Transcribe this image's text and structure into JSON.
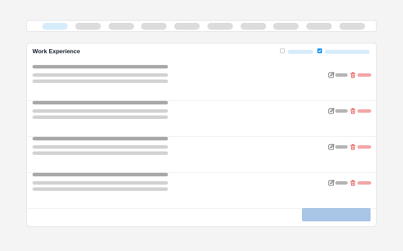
{
  "tabs": [
    {
      "active": true
    },
    {
      "active": false
    },
    {
      "active": false
    },
    {
      "active": false
    },
    {
      "active": false
    },
    {
      "active": false
    },
    {
      "active": false
    },
    {
      "active": false
    },
    {
      "active": false
    },
    {
      "active": false
    }
  ],
  "section": {
    "title": "Work Experience",
    "header_checkboxes": [
      {
        "checked": false
      },
      {
        "checked": true
      }
    ]
  },
  "entries": [
    {
      "id": 1
    },
    {
      "id": 2
    },
    {
      "id": 3
    },
    {
      "id": 4
    }
  ],
  "icons": {
    "edit": "edit-icon",
    "delete": "trash-icon"
  },
  "colors": {
    "accent": "#2196f3",
    "active_tab": "#d7ecfb",
    "delete": "#e53935",
    "save_button": "#a9c6e8"
  }
}
